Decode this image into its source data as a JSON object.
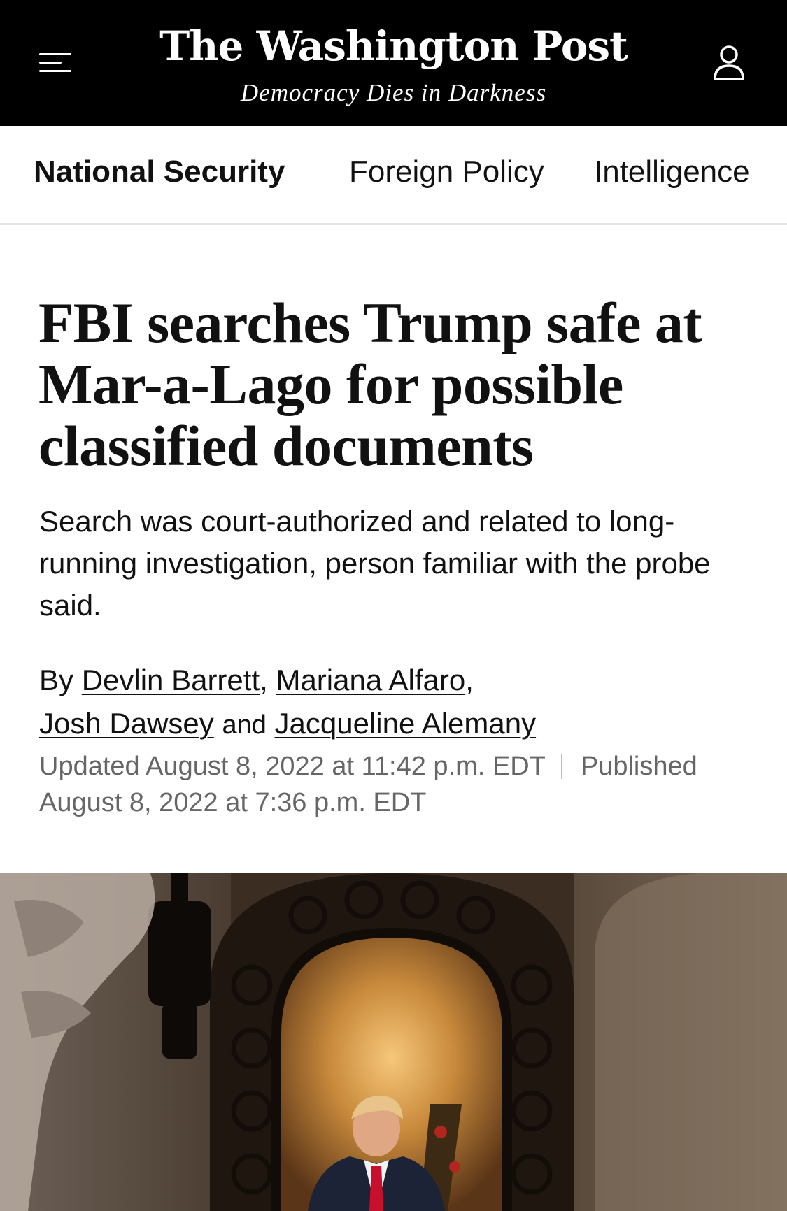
{
  "masthead": {
    "logo": "The Washington Post",
    "tagline": "Democracy Dies in Darkness",
    "menu_icon": "hamburger-menu-icon",
    "account_icon": "user-account-icon"
  },
  "section_nav": {
    "items": [
      {
        "label": "National Security",
        "active": true
      },
      {
        "label": "Foreign Policy",
        "active": false
      },
      {
        "label": "Intelligence",
        "active": false
      }
    ]
  },
  "article": {
    "headline": "FBI searches Trump safe at Mar-a-Lago for possible classified documents",
    "dek": "Search was court-authorized and related to long-running investigation, person familiar with the probe said.",
    "byline": {
      "prefix": "By",
      "authors": [
        "Devlin Barrett",
        "Mariana Alfaro",
        "Josh Dawsey",
        "Jacqueline Alemany"
      ],
      "separator": ",",
      "conjunction": "and"
    },
    "updated": "Updated August 8, 2022 at 11:42 p.m. EDT",
    "published": "Published August 8, 2022 at 7:36 p.m. EDT"
  },
  "colors": {
    "masthead_bg": "#000000",
    "text": "#111111",
    "meta_text": "#666666",
    "divider": "#e5e5e5"
  }
}
